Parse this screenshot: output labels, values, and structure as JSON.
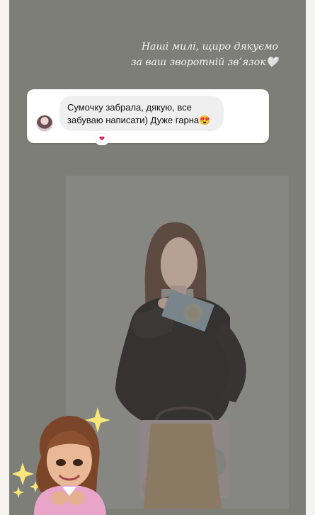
{
  "story": {
    "caption_line1": "Наші милі, щиро дякуємо",
    "caption_line2": "за ваш зворотній зв’язок",
    "caption_heart": "🤍"
  },
  "comment": {
    "text_line1": "Сумочку забрала, дякую, все",
    "text_line2": "забуваю написати) Дуже гарна",
    "emoji": "😍",
    "reaction": "❤"
  },
  "icons": {
    "avatar": "avatar",
    "sticker": "memoji-sticker",
    "sparkles": "sparkles-icon"
  },
  "colors": {
    "story_bg": "#7e7e79",
    "card_bg": "#ffffff",
    "bubble_bg": "#efefef",
    "heart": "#e3224b"
  }
}
